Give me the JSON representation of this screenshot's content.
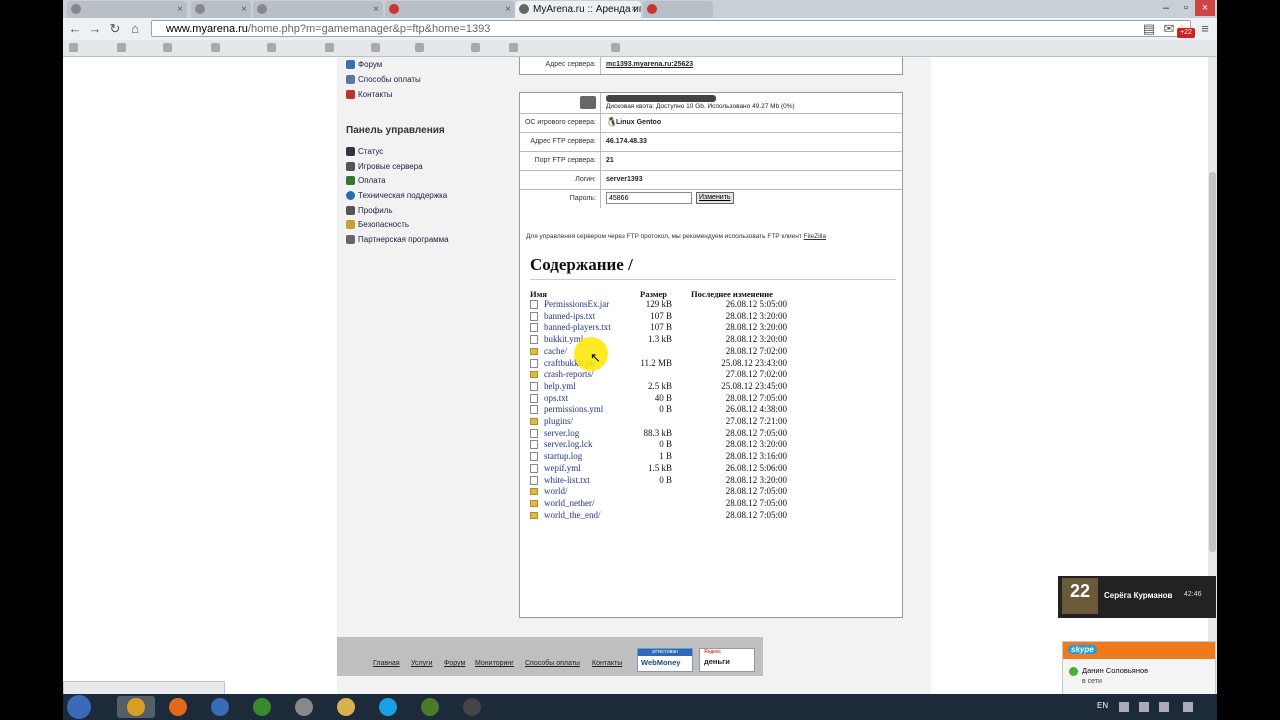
{
  "browser": {
    "tabs": [
      {
        "label": "",
        "active": false
      },
      {
        "label": "",
        "active": false
      },
      {
        "label": "",
        "active": false
      },
      {
        "label": "",
        "active": false
      },
      {
        "label": "MyArena.ru :: Аренда игрс",
        "active": true
      },
      {
        "label": "",
        "active": false
      }
    ],
    "url_domain": "www.myarena.ru",
    "url_path": "/home.php?m=gamemanager&p=ftp&home=1393",
    "extension_badge": "+22"
  },
  "sidebar": {
    "links_top": [
      {
        "label": "Форум",
        "icon": "forum-icon",
        "color": "#3a6fb0"
      },
      {
        "label": "Способы оплаты",
        "icon": "payment-icon",
        "color": "#5577aa"
      },
      {
        "label": "Контакты",
        "icon": "phone-icon",
        "color": "#c03030"
      }
    ],
    "panel_title": "Панель управления",
    "links": [
      {
        "label": "Статус",
        "icon": "status-icon",
        "color": "#334"
      },
      {
        "label": "Игровые сервера",
        "icon": "gamepad-icon",
        "color": "#555"
      },
      {
        "label": "Оплата",
        "icon": "money-icon",
        "color": "#2f7a2f"
      },
      {
        "label": "Техническая поддержка",
        "icon": "support-icon",
        "color": "#2a6ab8"
      },
      {
        "label": "Профиль",
        "icon": "profile-icon",
        "color": "#555"
      },
      {
        "label": "Безопасность",
        "icon": "shield-icon",
        "color": "#c8a030"
      },
      {
        "label": "Партнерская программа",
        "icon": "partner-icon",
        "color": "#666"
      }
    ]
  },
  "server": {
    "address_label": "Адрес сервера:",
    "address_value": "mc1393.myarena.ru:25623",
    "disk_quota": "Дисковая квота: Доступно 10 Gb. Использовано 49.27 Mb (0%)",
    "os_label": "ОС игрового сервера:",
    "os_value": "Linux Gentoo",
    "ftp_address_label": "Адрес FTP сервера:",
    "ftp_address_value": "46.174.48.33",
    "ftp_port_label": "Порт FTP сервера:",
    "ftp_port_value": "21",
    "login_label": "Логин:",
    "login_value": "server1393",
    "password_label": "Пароль:",
    "password_value": "45866",
    "change_button": "Изменить",
    "ftp_note_prefix": "Для управления сервером через FTP протокол, мы рекомендуем использовать FTP клиент ",
    "ftp_note_link": "FileZilla"
  },
  "listing": {
    "title": "Содержание /",
    "headers": {
      "name": "Имя",
      "size": "Размер",
      "modified": "Последнее изменение"
    },
    "rows": [
      {
        "type": "file",
        "name": "PermissionsEx.jar",
        "size": "129 kB",
        "date": "26.08.12 5:05:00"
      },
      {
        "type": "file",
        "name": "banned-ips.txt",
        "size": "107 B",
        "date": "28.08.12 3:20:00"
      },
      {
        "type": "file",
        "name": "banned-players.txt",
        "size": "107 B",
        "date": "28.08.12 3:20:00"
      },
      {
        "type": "file",
        "name": "bukkit.yml",
        "size": "1.3 kB",
        "date": "28.08.12 3:20:00"
      },
      {
        "type": "dir",
        "name": "cache/",
        "size": "",
        "date": "28.08.12 7:02:00"
      },
      {
        "type": "file",
        "name": "craftbukkit.jar",
        "size": "11.2 MB",
        "date": "25.08.12 23:43:00"
      },
      {
        "type": "dir",
        "name": "crash-reports/",
        "size": "",
        "date": "27.08.12 7:02:00"
      },
      {
        "type": "file",
        "name": "help.yml",
        "size": "2.5 kB",
        "date": "25.08.12 23:45:00"
      },
      {
        "type": "file",
        "name": "ops.txt",
        "size": "40 B",
        "date": "28.08.12 7:05:00"
      },
      {
        "type": "file",
        "name": "permissions.yml",
        "size": "0 B",
        "date": "26.08.12 4:38:00"
      },
      {
        "type": "dir",
        "name": "plugins/",
        "size": "",
        "date": "27.08.12 7:21:00"
      },
      {
        "type": "file",
        "name": "server.log",
        "size": "88.3 kB",
        "date": "28.08.12 7:05:00"
      },
      {
        "type": "file",
        "name": "server.log.lck",
        "size": "0 B",
        "date": "28.08.12 3:20:00"
      },
      {
        "type": "file",
        "name": "startup.log",
        "size": "1 B",
        "date": "28.08.12 3:16:00"
      },
      {
        "type": "file",
        "name": "wepif.yml",
        "size": "1.5 kB",
        "date": "26.08.12 5:06:00"
      },
      {
        "type": "file",
        "name": "white-list.txt",
        "size": "0 B",
        "date": "28.08.12 3:20:00"
      },
      {
        "type": "dir",
        "name": "world/",
        "size": "",
        "date": "28.08.12 7:05:00"
      },
      {
        "type": "dir",
        "name": "world_nether/",
        "size": "",
        "date": "28.08.12 7:05:00"
      },
      {
        "type": "dir",
        "name": "world_the_end/",
        "size": "",
        "date": "28.08.12 7:05:00"
      }
    ]
  },
  "footer": {
    "links": [
      "Главная",
      "Услуги",
      "Форум",
      "Мониторинг",
      "Способы оплаты",
      "Контакты"
    ],
    "webmoney_top": "аттестован",
    "webmoney": "WebMoney",
    "yandex_top": "Яндекс",
    "yandex": "деньги"
  },
  "taskbar": {
    "lang": "EN",
    "items": [
      {
        "icon": "chrome-icon",
        "color": "#d8a020"
      },
      {
        "icon": "firefox-icon",
        "color": "#e06a1a"
      },
      {
        "icon": "network-icon",
        "color": "#3a6ab8"
      },
      {
        "icon": "utorrent-icon",
        "color": "#3a8a2a"
      },
      {
        "icon": "disk-icon",
        "color": "#888"
      },
      {
        "icon": "folder-icon",
        "color": "#d8b050"
      },
      {
        "icon": "skype-icon",
        "color": "#1aa0e0"
      },
      {
        "icon": "minecraft-icon",
        "color": "#4a7a2a"
      },
      {
        "icon": "app-icon",
        "color": "#444"
      }
    ]
  },
  "notifications": {
    "game_toast": {
      "name": "Серёга Курманов",
      "time": "42:46",
      "badge": "22"
    },
    "skype_toast": {
      "brand": "skype",
      "name": "Данин Соловьянов",
      "status": "в сети"
    }
  }
}
